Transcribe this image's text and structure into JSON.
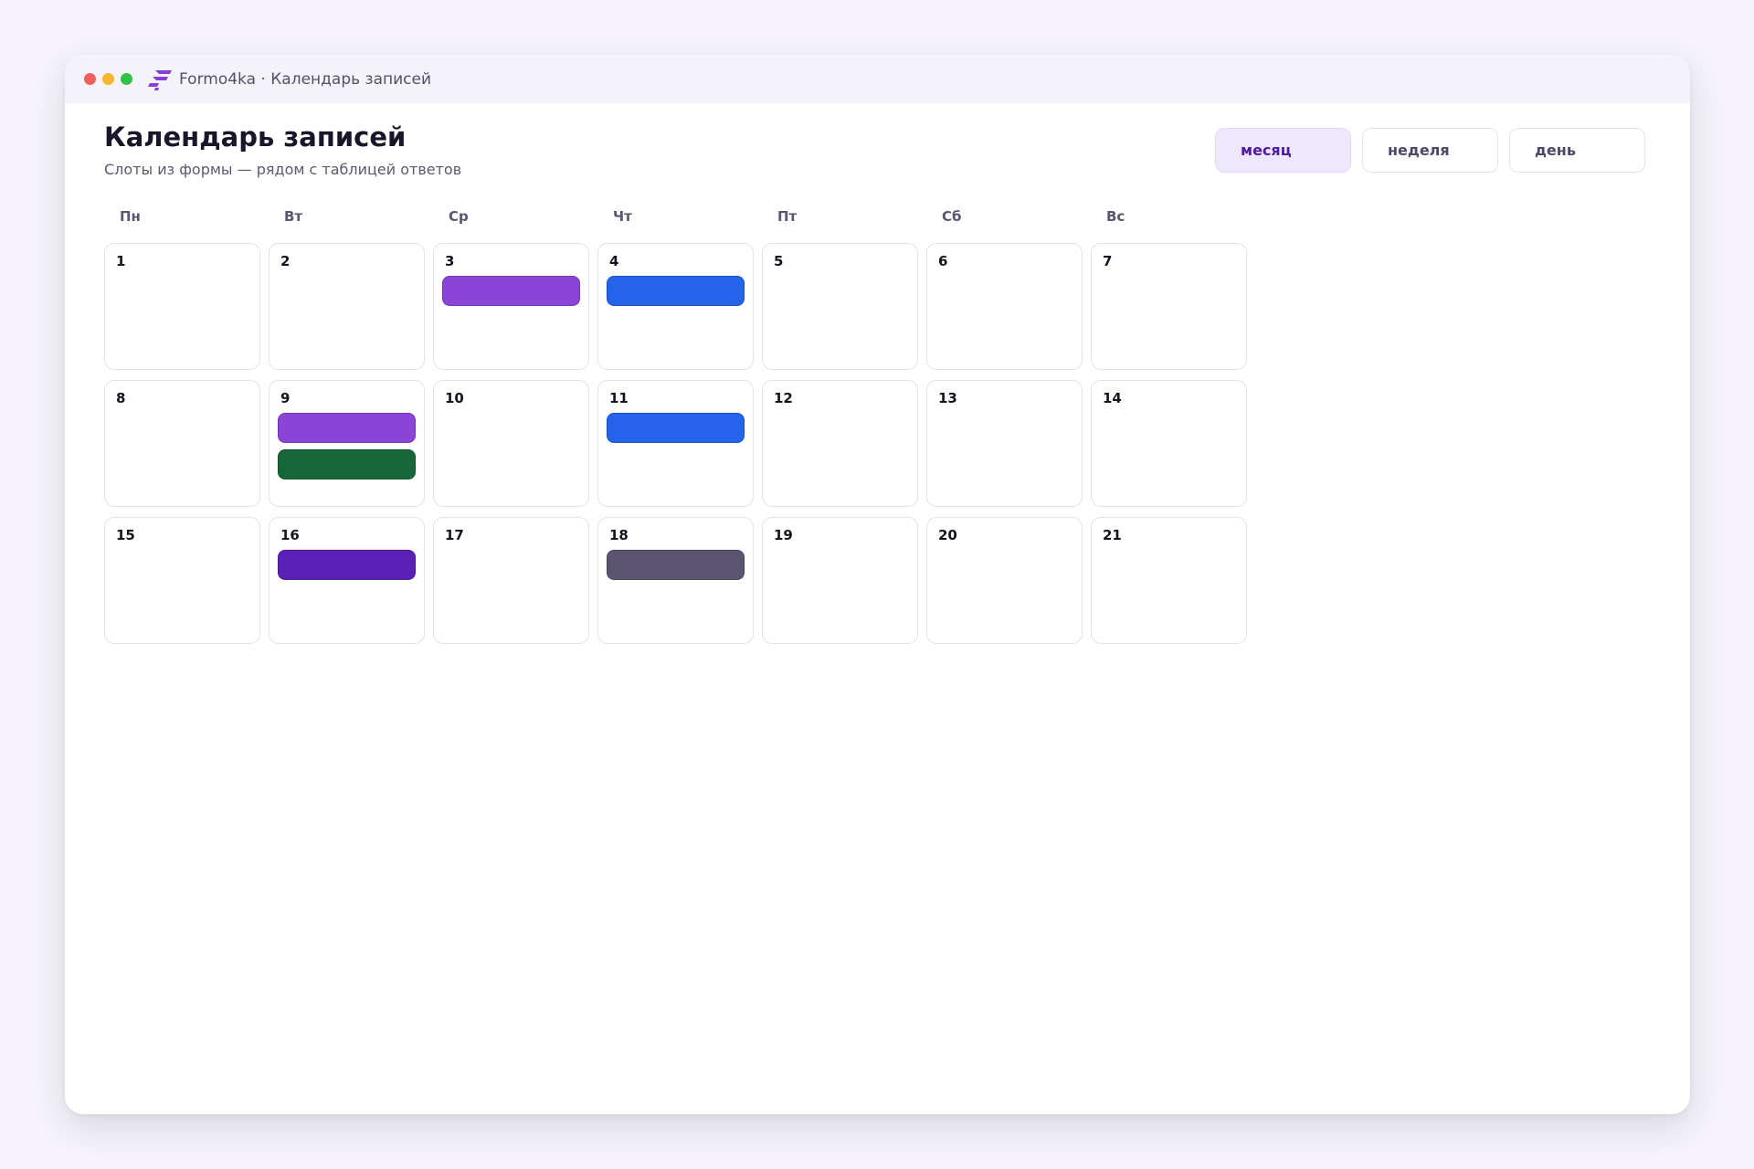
{
  "window": {
    "title": "Formo4ka · Календарь записей",
    "logo_icon": "formo4ka-logo-icon",
    "logo_color": "#8a3fd4"
  },
  "header": {
    "title": "Календарь записей",
    "subtitle": "Слоты из формы — рядом с таблицей ответов"
  },
  "view_switch": {
    "options": [
      "месяц",
      "неделя",
      "день"
    ],
    "selected": "месяц"
  },
  "weekdays": [
    "Пн",
    "Вт",
    "Ср",
    "Чт",
    "Пт",
    "Сб",
    "Вс"
  ],
  "colors": {
    "accent": "#4d1ca3",
    "event_purple": "#8a45d6",
    "event_blue": "#2563eb",
    "event_green": "#166637",
    "event_violet": "#5b21b6",
    "event_gray": "#5a5470"
  },
  "days": [
    {
      "number": "1",
      "events": []
    },
    {
      "number": "2",
      "events": []
    },
    {
      "number": "3",
      "events": [
        "#8a45d6"
      ]
    },
    {
      "number": "4",
      "events": [
        "#2563eb"
      ]
    },
    {
      "number": "5",
      "events": []
    },
    {
      "number": "6",
      "events": []
    },
    {
      "number": "7",
      "events": []
    },
    {
      "number": "8",
      "events": []
    },
    {
      "number": "9",
      "events": [
        "#8a45d6",
        "#166637"
      ]
    },
    {
      "number": "10",
      "events": []
    },
    {
      "number": "11",
      "events": [
        "#2563eb"
      ]
    },
    {
      "number": "12",
      "events": []
    },
    {
      "number": "13",
      "events": []
    },
    {
      "number": "14",
      "events": []
    },
    {
      "number": "15",
      "events": []
    },
    {
      "number": "16",
      "events": [
        "#5b21b6"
      ]
    },
    {
      "number": "17",
      "events": []
    },
    {
      "number": "18",
      "events": [
        "#5a5470"
      ]
    },
    {
      "number": "19",
      "events": []
    },
    {
      "number": "20",
      "events": []
    },
    {
      "number": "21",
      "events": []
    }
  ]
}
